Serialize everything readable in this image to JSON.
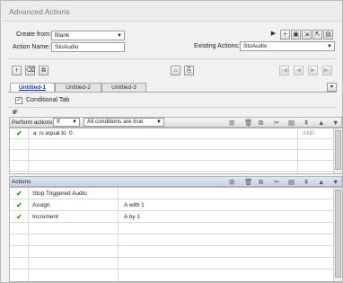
{
  "window": {
    "title": "Advanced Actions"
  },
  "form": {
    "create_from_label": "Create from:",
    "create_from_value": "Blank",
    "action_name_label": "Action Name:",
    "action_name_value": "StoAudio",
    "existing_actions_label": "Existing Actions:",
    "existing_actions_value": "StoAudio"
  },
  "tabs": [
    {
      "label": "Untitled-1",
      "active": true
    },
    {
      "label": "Untitled-2",
      "active": false
    },
    {
      "label": "Untitled-3",
      "active": false
    }
  ],
  "conditional_tab": {
    "label": "Conditional Tab",
    "checked": true
  },
  "if_section": {
    "label": "IF",
    "perform_actions_label": "Perform actions:",
    "perform_actions_value": "If",
    "conditions_value": "All conditions are true",
    "condition_rows": [
      {
        "checked": true,
        "variable": "a",
        "operator": "is equal to",
        "value": "0",
        "logic": "AND"
      }
    ]
  },
  "actions_section": {
    "label": "Actions",
    "rows": [
      {
        "checked": true,
        "action": "Stop Triggered Audio",
        "target": ""
      },
      {
        "checked": true,
        "action": "Assign",
        "target": "A   with   1"
      },
      {
        "checked": true,
        "action": "Increment",
        "target": "A   by   1"
      }
    ]
  },
  "icons": {
    "check": "✔",
    "play": "▶",
    "add": "+",
    "delete": "🗑",
    "duplicate": "⧉",
    "dropdown": "▼",
    "first": "⏮",
    "prev": "◀",
    "next": "▶",
    "last": "⏭",
    "up": "▲",
    "down": "▼"
  },
  "colors": {
    "check": "#3a9a2a",
    "active_tab": "#1a33a8"
  }
}
